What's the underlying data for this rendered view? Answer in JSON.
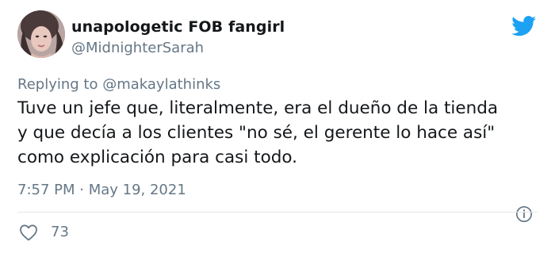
{
  "user": {
    "display_name": "unapologetic FOB fangirl",
    "handle": "@MidnighterSarah",
    "avatar_icon": "profile-photo"
  },
  "brand_icon": "twitter-bird-icon",
  "reply": {
    "prefix": "Replying to",
    "mention": "@makaylathinks"
  },
  "tweet": {
    "lines": [
      "Tuve un jefe que, literalmente, era el dueño de la tienda",
      "y que decía a los clientes \"no sé, el gerente lo hace así\"",
      "como explicación para casi todo."
    ],
    "timestamp": "7:57 PM · May 19, 2021"
  },
  "actions": {
    "like_icon": "heart-icon",
    "like_count": "73",
    "info_icon": "info-icon"
  },
  "colors": {
    "text": "#14171a",
    "muted": "#657786",
    "brand": "#1da1f2",
    "divider": "#e1e8ed"
  }
}
